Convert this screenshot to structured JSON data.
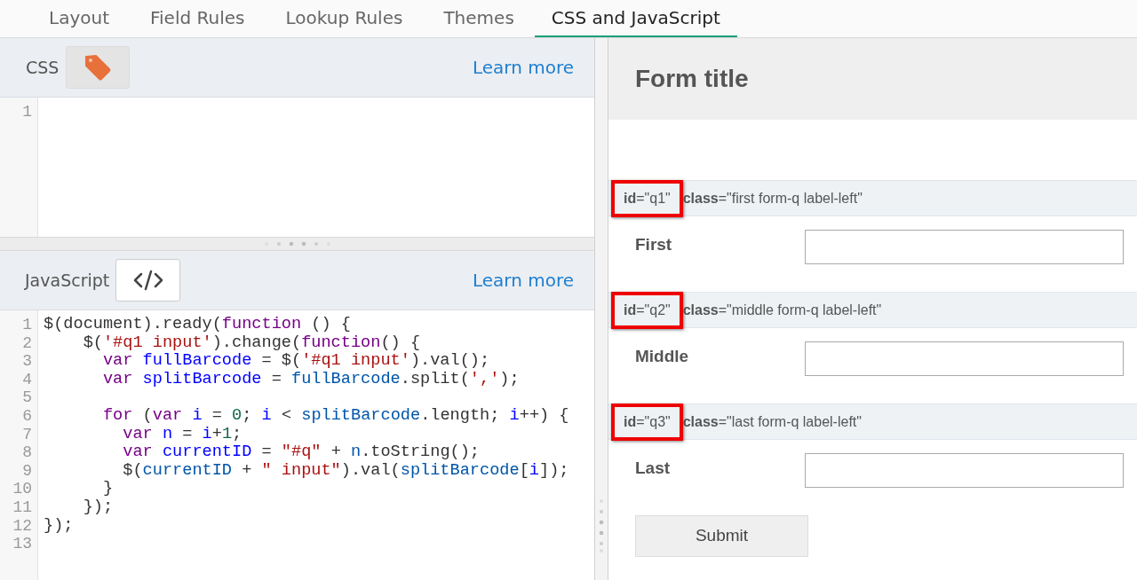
{
  "tabs": [
    {
      "label": "Layout",
      "selected": false
    },
    {
      "label": "Field Rules",
      "selected": false
    },
    {
      "label": "Lookup Rules",
      "selected": false
    },
    {
      "label": "Themes",
      "selected": false
    },
    {
      "label": "CSS and JavaScript",
      "selected": true
    }
  ],
  "css_panel": {
    "title": "CSS",
    "learn_more": "Learn more",
    "line_numbers": [
      "1"
    ]
  },
  "js_panel": {
    "title": "JavaScript",
    "learn_more": "Learn more",
    "lines": [
      {
        "number": "1",
        "tokens": [
          {
            "kind": "plain",
            "text": "$(document).ready("
          },
          {
            "kind": "keyword",
            "text": "function"
          },
          {
            "kind": "plain",
            "text": " () {"
          }
        ]
      },
      {
        "number": "2",
        "tokens": [
          {
            "kind": "plain",
            "text": "    $("
          },
          {
            "kind": "string",
            "text": "'#q1 input'"
          },
          {
            "kind": "plain",
            "text": ").change("
          },
          {
            "kind": "keyword",
            "text": "function"
          },
          {
            "kind": "plain",
            "text": "() {"
          }
        ]
      },
      {
        "number": "3",
        "tokens": [
          {
            "kind": "keyword",
            "text": "      var "
          },
          {
            "kind": "def",
            "text": "fullBarcode"
          },
          {
            "kind": "plain",
            "text": " = $("
          },
          {
            "kind": "string",
            "text": "'#q1 input'"
          },
          {
            "kind": "plain",
            "text": ").val();"
          }
        ]
      },
      {
        "number": "4",
        "tokens": [
          {
            "kind": "keyword",
            "text": "      var "
          },
          {
            "kind": "def",
            "text": "splitBarcode"
          },
          {
            "kind": "plain",
            "text": " = "
          },
          {
            "kind": "variable",
            "text": "fullBarcode"
          },
          {
            "kind": "plain",
            "text": ".split("
          },
          {
            "kind": "string",
            "text": "','"
          },
          {
            "kind": "plain",
            "text": ");"
          }
        ]
      },
      {
        "number": "5"
      },
      {
        "number": "6",
        "tokens": [
          {
            "kind": "keyword",
            "text": "      for"
          },
          {
            "kind": "plain",
            "text": " ("
          },
          {
            "kind": "keyword",
            "text": "var "
          },
          {
            "kind": "def",
            "text": "i"
          },
          {
            "kind": "plain",
            "text": " = "
          },
          {
            "kind": "number",
            "text": "0"
          },
          {
            "kind": "plain",
            "text": "; "
          },
          {
            "kind": "def",
            "text": "i"
          },
          {
            "kind": "plain",
            "text": " < "
          },
          {
            "kind": "variable",
            "text": "splitBarcode"
          },
          {
            "kind": "plain",
            "text": ".length; "
          },
          {
            "kind": "def",
            "text": "i"
          },
          {
            "kind": "plain",
            "text": "++) {"
          }
        ]
      },
      {
        "number": "7",
        "tokens": [
          {
            "kind": "keyword",
            "text": "        var "
          },
          {
            "kind": "def",
            "text": "n"
          },
          {
            "kind": "plain",
            "text": " = "
          },
          {
            "kind": "def",
            "text": "i"
          },
          {
            "kind": "plain",
            "text": "+"
          },
          {
            "kind": "number",
            "text": "1"
          },
          {
            "kind": "plain",
            "text": ";"
          }
        ]
      },
      {
        "number": "8",
        "tokens": [
          {
            "kind": "keyword",
            "text": "        var "
          },
          {
            "kind": "def",
            "text": "currentID"
          },
          {
            "kind": "plain",
            "text": " = "
          },
          {
            "kind": "string",
            "text": "\"#q\""
          },
          {
            "kind": "plain",
            "text": " + "
          },
          {
            "kind": "variable",
            "text": "n"
          },
          {
            "kind": "plain",
            "text": ".toString();"
          }
        ]
      },
      {
        "number": "9",
        "tokens": [
          {
            "kind": "plain",
            "text": "        $("
          },
          {
            "kind": "variable",
            "text": "currentID"
          },
          {
            "kind": "plain",
            "text": " + "
          },
          {
            "kind": "string",
            "text": "\" input\""
          },
          {
            "kind": "plain",
            "text": ").val("
          },
          {
            "kind": "variable",
            "text": "splitBarcode"
          },
          {
            "kind": "plain",
            "text": "["
          },
          {
            "kind": "def",
            "text": "i"
          },
          {
            "kind": "plain",
            "text": "]);"
          }
        ]
      },
      {
        "number": "10",
        "tokens": [
          {
            "kind": "plain",
            "text": "      }"
          }
        ]
      },
      {
        "number": "11",
        "tokens": [
          {
            "kind": "plain",
            "text": "    });"
          }
        ]
      },
      {
        "number": "12",
        "tokens": [
          {
            "kind": "plain",
            "text": "});"
          }
        ]
      },
      {
        "number": "13"
      }
    ]
  },
  "preview": {
    "form_title": "Form title",
    "questions": [
      {
        "id_attr": "**id**=\"q1\"",
        "class_attr": "**class**=\"first form-q label-left\"",
        "highlighted": true,
        "label": "First"
      },
      {
        "id_attr": "**id**=\"q2\"",
        "class_attr": "**class**=\"middle form-q label-left\"",
        "highlighted": true,
        "label": "Middle"
      },
      {
        "id_attr": "**id**=\"q3\"",
        "class_attr": "**class**=\"last form-q label-left\"",
        "highlighted": true,
        "label": "Last"
      }
    ],
    "submit": "Submit"
  }
}
